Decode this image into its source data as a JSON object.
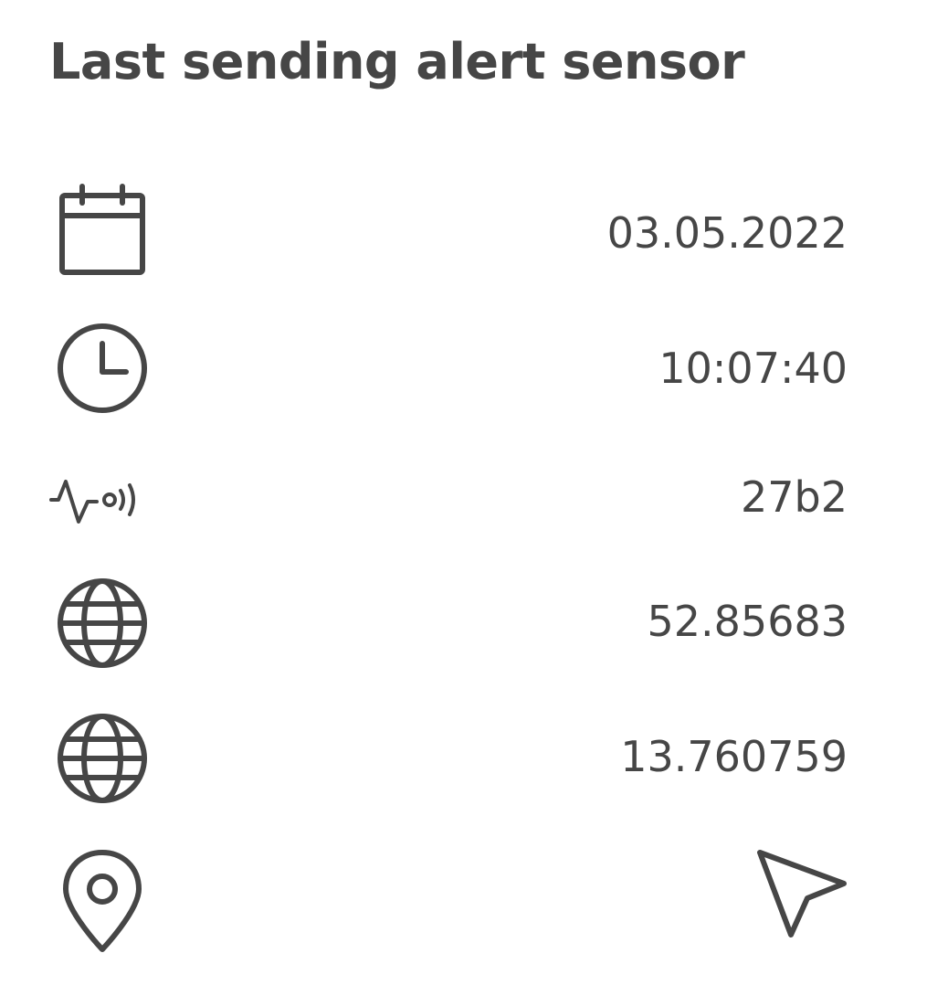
{
  "title": "Last sending alert sensor",
  "rows": [
    {
      "icon": "calendar-icon",
      "value": "03.05.2022"
    },
    {
      "icon": "clock-icon",
      "value": "10:07:40"
    },
    {
      "icon": "sensor-signal-icon",
      "value": "27b2"
    },
    {
      "icon": "globe-icon",
      "value": "52.85683"
    },
    {
      "icon": "globe-icon",
      "value": "13.760759"
    },
    {
      "icon": "map-pin-icon",
      "action_icon": "navigation-arrow-icon"
    }
  ],
  "colors": {
    "text": "#464646",
    "icon_stroke": "#464646",
    "background": "#ffffff"
  }
}
